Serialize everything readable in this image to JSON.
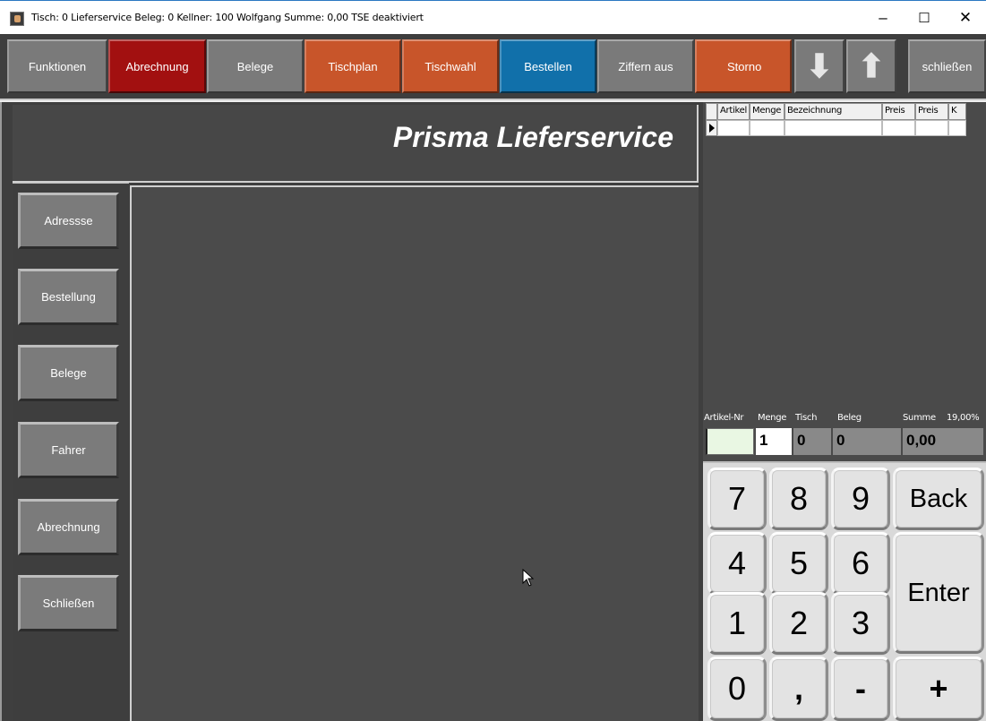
{
  "window": {
    "title": "Tisch: 0 Lieferservice  Beleg: 0  Kellner: 100 Wolfgang  Summe: 0,00  TSE deaktiviert",
    "minimize": "–",
    "maximize": "☐",
    "close": "✕"
  },
  "toolbar": {
    "buttons": [
      {
        "label": "Funktionen",
        "color": "#7a7a7a"
      },
      {
        "label": "Abrechnung",
        "color": "#a21010"
      },
      {
        "label": "Belege",
        "color": "#7a7a7a"
      },
      {
        "label": "Tischplan",
        "color": "#c8552a"
      },
      {
        "label": "Tischwahl",
        "color": "#c8552a"
      },
      {
        "label": "Bestellen",
        "color": "#1170aa"
      },
      {
        "label": "Ziffern aus",
        "color": "#7a7a7a"
      },
      {
        "label": "Storno",
        "color": "#c8552a"
      },
      {
        "label": "schließen",
        "color": "#7a7a7a"
      }
    ],
    "arrow_down": "⬇",
    "arrow_up": "⬆"
  },
  "header": {
    "title": "Prisma Lieferservice"
  },
  "sidebar": {
    "items": [
      {
        "label": "Adressse"
      },
      {
        "label": "Bestellung"
      },
      {
        "label": "Belege"
      },
      {
        "label": "Fahrer"
      },
      {
        "label": "Abrechnung"
      },
      {
        "label": "Schließen"
      }
    ]
  },
  "grid": {
    "columns": [
      "Artikel",
      "Menge",
      "Bezeichnung",
      "Preis",
      "Preis",
      "K"
    ]
  },
  "info": {
    "labels": {
      "artikel_nr": "Artikel-Nr",
      "menge": "Menge",
      "tisch": "Tisch",
      "beleg": "Beleg",
      "summe": "Summe",
      "tax": "19,00%"
    },
    "values": {
      "artikel_nr": "",
      "menge": "1",
      "tisch": "0",
      "beleg": "0",
      "summe": "0,00"
    }
  },
  "keypad": {
    "k7": "7",
    "k8": "8",
    "k9": "9",
    "back": "Back",
    "k4": "4",
    "k5": "5",
    "k6": "6",
    "enter": "Enter",
    "k1": "1",
    "k2": "2",
    "k3": "3",
    "k0": "0",
    "comma": ",",
    "minus": "-",
    "plus": "+"
  }
}
